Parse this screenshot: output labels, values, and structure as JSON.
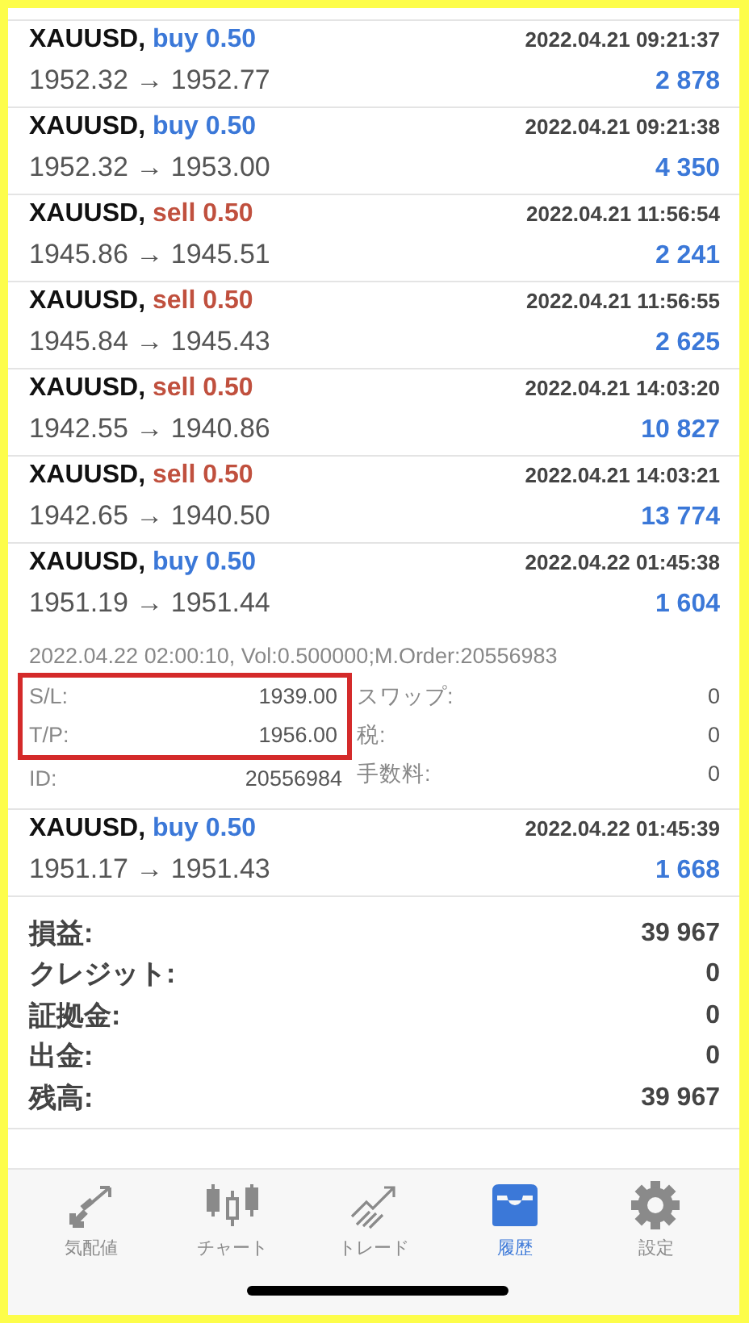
{
  "trades": [
    {
      "symbol": "XAUUSD,",
      "side": "buy 0.50",
      "color": "#3b78d8",
      "time": "2022.04.21 09:21:37",
      "prices": "1952.32 → 1952.77",
      "profit": "2 878"
    },
    {
      "symbol": "XAUUSD,",
      "side": "buy 0.50",
      "color": "#3b78d8",
      "time": "2022.04.21 09:21:38",
      "prices": "1952.32 → 1953.00",
      "profit": "4 350"
    },
    {
      "symbol": "XAUUSD,",
      "side": "sell 0.50",
      "color": "#c0503e",
      "time": "2022.04.21 11:56:54",
      "prices": "1945.86 → 1945.51",
      "profit": "2 241"
    },
    {
      "symbol": "XAUUSD,",
      "side": "sell 0.50",
      "color": "#c0503e",
      "time": "2022.04.21 11:56:55",
      "prices": "1945.84 → 1945.43",
      "profit": "2 625"
    },
    {
      "symbol": "XAUUSD,",
      "side": "sell 0.50",
      "color": "#c0503e",
      "time": "2022.04.21 14:03:20",
      "prices": "1942.55 → 1940.86",
      "profit": "10 827"
    },
    {
      "symbol": "XAUUSD,",
      "side": "sell 0.50",
      "color": "#c0503e",
      "time": "2022.04.21 14:03:21",
      "prices": "1942.65 → 1940.50",
      "profit": "13 774"
    },
    {
      "symbol": "XAUUSD,",
      "side": "buy 0.50",
      "color": "#3b78d8",
      "time": "2022.04.22 01:45:38",
      "prices": "1951.19 → 1951.44",
      "profit": "1 604",
      "expanded": true,
      "details": {
        "comment": "2022.04.22 02:00:10, Vol:0.500000;M.Order:20556983",
        "left": [
          {
            "label": "S/L:",
            "value": "1939.00",
            "highlighted": true
          },
          {
            "label": "T/P:",
            "value": "1956.00",
            "highlighted": true
          },
          {
            "label": "ID:",
            "value": "20556984",
            "highlighted": false
          }
        ],
        "right": [
          {
            "label": "スワップ:",
            "value": "0"
          },
          {
            "label": "税:",
            "value": "0"
          },
          {
            "label": "手数料:",
            "value": "0"
          }
        ]
      }
    },
    {
      "symbol": "XAUUSD,",
      "side": "buy 0.50",
      "color": "#3b78d8",
      "time": "2022.04.22 01:45:39",
      "prices": "1951.17 → 1951.43",
      "profit": "1 668"
    }
  ],
  "summary": [
    {
      "label": "損益:",
      "value": "39 967"
    },
    {
      "label": "クレジット:",
      "value": "0"
    },
    {
      "label": "証拠金:",
      "value": "0"
    },
    {
      "label": "出金:",
      "value": "0"
    },
    {
      "label": "残高:",
      "value": "39 967"
    }
  ],
  "tabs": [
    {
      "label": "気配値",
      "kind": "quotes",
      "selected": false
    },
    {
      "label": "チャート",
      "kind": "chart",
      "selected": false
    },
    {
      "label": "トレード",
      "kind": "trade",
      "selected": false
    },
    {
      "label": "履歴",
      "kind": "history",
      "selected": true
    },
    {
      "label": "設定",
      "kind": "settings",
      "selected": false
    }
  ]
}
